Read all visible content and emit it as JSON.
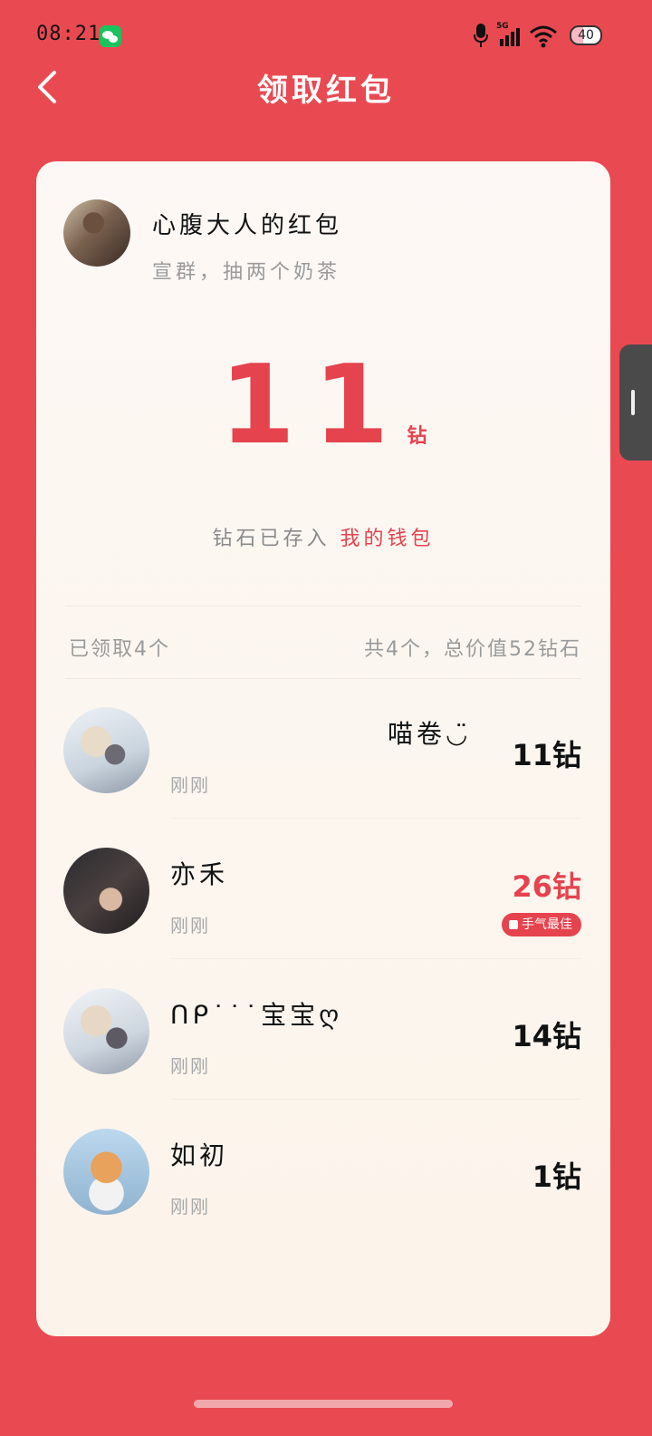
{
  "status_bar": {
    "time": "08:21",
    "network": "5G",
    "battery": "40"
  },
  "header": {
    "title": "领取红包"
  },
  "packet": {
    "sender_title": "心腹大人的红包",
    "greeting": "宣群，抽两个奶茶",
    "amount": "11",
    "unit": "钻",
    "deposit_text": "钻石已存入",
    "deposit_link": "我的钱包"
  },
  "summary": {
    "claimed": "已领取4个",
    "total": "共4个，总价值52钻石"
  },
  "records": [
    {
      "name": "喵卷◡̈",
      "time": "刚刚",
      "amount": "11钻"
    },
    {
      "name": "亦禾",
      "time": "刚刚",
      "amount": "26钻",
      "badge": "手气最佳"
    },
    {
      "name": "ᑎᑭ˙˙˙宝宝ღ",
      "time": "刚刚",
      "amount": "14钻"
    },
    {
      "name": "如初",
      "time": "刚刚",
      "amount": "1钻"
    }
  ],
  "colors": {
    "background": "#E94A52",
    "accent": "#E5434E",
    "card": "#FDF8F5"
  }
}
